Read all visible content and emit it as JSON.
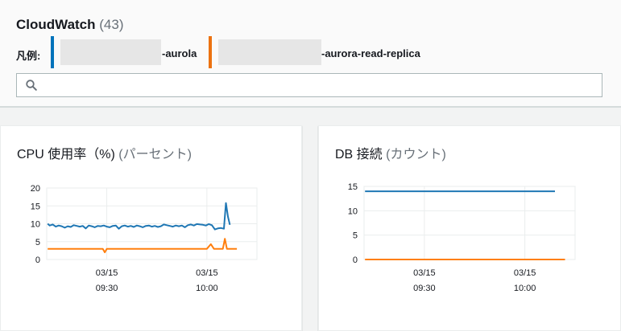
{
  "header": {
    "title": "CloudWatch",
    "count": "(43)",
    "legend_label": "凡例:",
    "legend": [
      {
        "suffix": "-aurola",
        "color": "#0073bb"
      },
      {
        "suffix": "-aurora-read-replica",
        "color": "#ec7211"
      }
    ],
    "search_placeholder": ""
  },
  "cards": [
    {
      "title": "CPU 使用率（%)",
      "unit": "(パーセント)"
    },
    {
      "title": "DB 接続",
      "unit": "(カウント)"
    }
  ],
  "chart_data": [
    {
      "type": "line",
      "title": "CPU 使用率（%)",
      "ylabel": "(パーセント)",
      "ylim": [
        0,
        20
      ],
      "y_ticks": [
        0,
        5,
        10,
        15,
        20
      ],
      "x_ticks": [
        {
          "t": 9.5,
          "label": [
            "03/15",
            "09:30"
          ]
        },
        {
          "t": 10.0,
          "label": [
            "03/15",
            "10:00"
          ]
        }
      ],
      "xlim": [
        9.2,
        10.25
      ],
      "grid": true,
      "series": [
        {
          "color": "#1f77b4",
          "points": [
            [
              9.205,
              10.0
            ],
            [
              9.215,
              9.5
            ],
            [
              9.23,
              9.8
            ],
            [
              9.245,
              9.2
            ],
            [
              9.26,
              9.5
            ],
            [
              9.275,
              9.3
            ],
            [
              9.29,
              8.9
            ],
            [
              9.305,
              9.3
            ],
            [
              9.32,
              9.1
            ],
            [
              9.335,
              9.6
            ],
            [
              9.35,
              9.4
            ],
            [
              9.365,
              9.2
            ],
            [
              9.38,
              9.4
            ],
            [
              9.395,
              8.7
            ],
            [
              9.41,
              9.5
            ],
            [
              9.425,
              9.3
            ],
            [
              9.44,
              9.0
            ],
            [
              9.455,
              9.4
            ],
            [
              9.47,
              9.3
            ],
            [
              9.485,
              9.5
            ],
            [
              9.5,
              9.2
            ],
            [
              9.515,
              9.0
            ],
            [
              9.53,
              9.4
            ],
            [
              9.545,
              9.5
            ],
            [
              9.56,
              8.6
            ],
            [
              9.575,
              9.3
            ],
            [
              9.59,
              9.5
            ],
            [
              9.605,
              9.2
            ],
            [
              9.62,
              9.4
            ],
            [
              9.635,
              9.1
            ],
            [
              9.65,
              9.5
            ],
            [
              9.665,
              9.3
            ],
            [
              9.68,
              9.0
            ],
            [
              9.695,
              9.4
            ],
            [
              9.71,
              9.5
            ],
            [
              9.725,
              9.2
            ],
            [
              9.74,
              9.4
            ],
            [
              9.755,
              9.1
            ],
            [
              9.77,
              9.3
            ],
            [
              9.785,
              9.8
            ],
            [
              9.8,
              9.6
            ],
            [
              9.815,
              9.4
            ],
            [
              9.83,
              9.2
            ],
            [
              9.845,
              9.5
            ],
            [
              9.86,
              9.3
            ],
            [
              9.875,
              9.5
            ],
            [
              9.89,
              9.0
            ],
            [
              9.905,
              9.6
            ],
            [
              9.92,
              9.8
            ],
            [
              9.935,
              9.5
            ],
            [
              9.95,
              9.9
            ],
            [
              9.965,
              9.8
            ],
            [
              9.98,
              9.7
            ],
            [
              9.995,
              9.5
            ],
            [
              10.01,
              9.9
            ],
            [
              10.025,
              9.6
            ],
            [
              10.04,
              8.4
            ],
            [
              10.055,
              8.7
            ],
            [
              10.07,
              8.8
            ],
            [
              10.085,
              8.6
            ],
            [
              10.095,
              15.8
            ],
            [
              10.105,
              12.0
            ],
            [
              10.115,
              9.7
            ]
          ]
        },
        {
          "color": "#ff7f0e",
          "points": [
            [
              9.205,
              3.0
            ],
            [
              9.3,
              3.0
            ],
            [
              9.4,
              3.0
            ],
            [
              9.48,
              3.0
            ],
            [
              9.49,
              2.0
            ],
            [
              9.5,
              3.0
            ],
            [
              9.6,
              3.0
            ],
            [
              9.7,
              3.0
            ],
            [
              9.8,
              3.0
            ],
            [
              9.9,
              3.0
            ],
            [
              10.0,
              3.0
            ],
            [
              10.02,
              4.3
            ],
            [
              10.035,
              3.0
            ],
            [
              10.08,
              3.0
            ],
            [
              10.09,
              5.8
            ],
            [
              10.1,
              3.0
            ],
            [
              10.15,
              3.0
            ]
          ]
        }
      ]
    },
    {
      "type": "line",
      "title": "DB 接続",
      "ylabel": "(カウント)",
      "ylim": [
        0,
        15
      ],
      "y_ticks": [
        0,
        5,
        10,
        15
      ],
      "x_ticks": [
        {
          "t": 9.5,
          "label": [
            "03/15",
            "09:30"
          ]
        },
        {
          "t": 10.0,
          "label": [
            "03/15",
            "10:00"
          ]
        }
      ],
      "xlim": [
        9.2,
        10.25
      ],
      "grid": true,
      "series": [
        {
          "color": "#1f77b4",
          "points": [
            [
              9.205,
              14
            ],
            [
              10.15,
              14
            ]
          ]
        },
        {
          "color": "#ff7f0e",
          "points": [
            [
              9.205,
              0
            ],
            [
              10.2,
              0
            ]
          ]
        }
      ]
    }
  ]
}
